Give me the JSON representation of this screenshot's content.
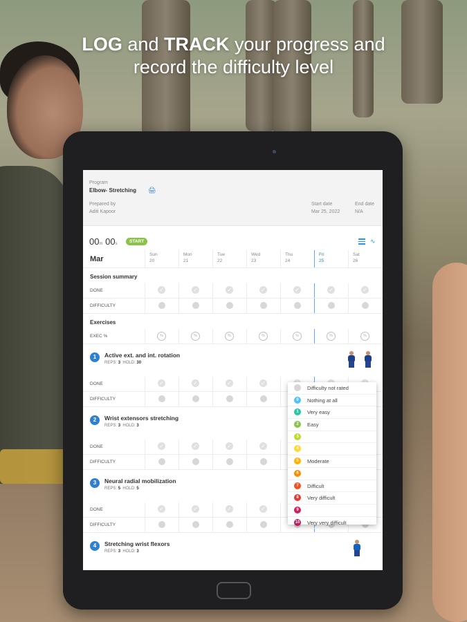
{
  "headline": {
    "strong1": "LOG",
    "text1": " and ",
    "strong2": "TRACK",
    "text2": " your progress and",
    "line2": "record the difficulty level"
  },
  "program": {
    "label": "Program",
    "name": "Elbow- Stretching",
    "prepared_label": "Prepared by",
    "prepared_by": "Aditi Kapoor",
    "start_label": "Start date",
    "start_date": "Mar 25, 2022",
    "end_label": "End date",
    "end_date": "N/A"
  },
  "timer": {
    "min": "00",
    "min_unit": "m",
    "sec": "00",
    "sec_unit": "s",
    "start_label": "START"
  },
  "calendar": {
    "month": "Mar",
    "days": [
      {
        "name": "Sun",
        "num": "20"
      },
      {
        "name": "Mon",
        "num": "21"
      },
      {
        "name": "Tue",
        "num": "22"
      },
      {
        "name": "Wed",
        "num": "23"
      },
      {
        "name": "Thu",
        "num": "24"
      },
      {
        "name": "Fri",
        "num": "25"
      },
      {
        "name": "Sat",
        "num": "26"
      }
    ]
  },
  "session": {
    "title": "Session summary",
    "done": "DONE",
    "difficulty": "DIFFICULTY"
  },
  "exercises_title": "Exercises",
  "exec_label": "EXEC %",
  "row_done": "DONE",
  "row_difficulty": "DIFFICULTY",
  "exercises": [
    {
      "num": "1",
      "title": "Active ext. and int. rotation",
      "reps_label": "REPS:",
      "reps": "3",
      "hold_label": "HOLD:",
      "hold": "30"
    },
    {
      "num": "2",
      "title": "Wrist extensors stretching",
      "reps_label": "REPS:",
      "reps": "3",
      "hold_label": "HOLD:",
      "hold": "3"
    },
    {
      "num": "3",
      "title": "Neural radial mobilization",
      "reps_label": "REPS:",
      "reps": "5",
      "hold_label": "HOLD:",
      "hold": "5"
    },
    {
      "num": "4",
      "title": "Stretching wrist flexors",
      "reps_label": "REPS:",
      "reps": "3",
      "hold_label": "HOLD:",
      "hold": "3"
    }
  ],
  "difficulty_options": [
    {
      "badge": "",
      "label": "Difficulty not rated",
      "color": "#d6d6d6"
    },
    {
      "badge": "0",
      "label": "Nothing at all",
      "color": "#4fc3f7"
    },
    {
      "badge": "1",
      "label": "Very easy",
      "color": "#26c6a6"
    },
    {
      "badge": "2",
      "label": "Easy",
      "color": "#8bc34a"
    },
    {
      "badge": "3",
      "label": "",
      "color": "#c0d92e"
    },
    {
      "badge": "4",
      "label": "",
      "color": "#fdd835"
    },
    {
      "badge": "5",
      "label": "Moderate",
      "color": "#ffb300"
    },
    {
      "badge": "6",
      "label": "",
      "color": "#fb8c00"
    },
    {
      "badge": "7",
      "label": "Difficult",
      "color": "#f4511e"
    },
    {
      "badge": "8",
      "label": "Very difficult",
      "color": "#e53935"
    },
    {
      "badge": "9",
      "label": "",
      "color": "#d81b60"
    },
    {
      "badge": "10",
      "label": "Very very difficult",
      "color": "#c2185b"
    }
  ]
}
